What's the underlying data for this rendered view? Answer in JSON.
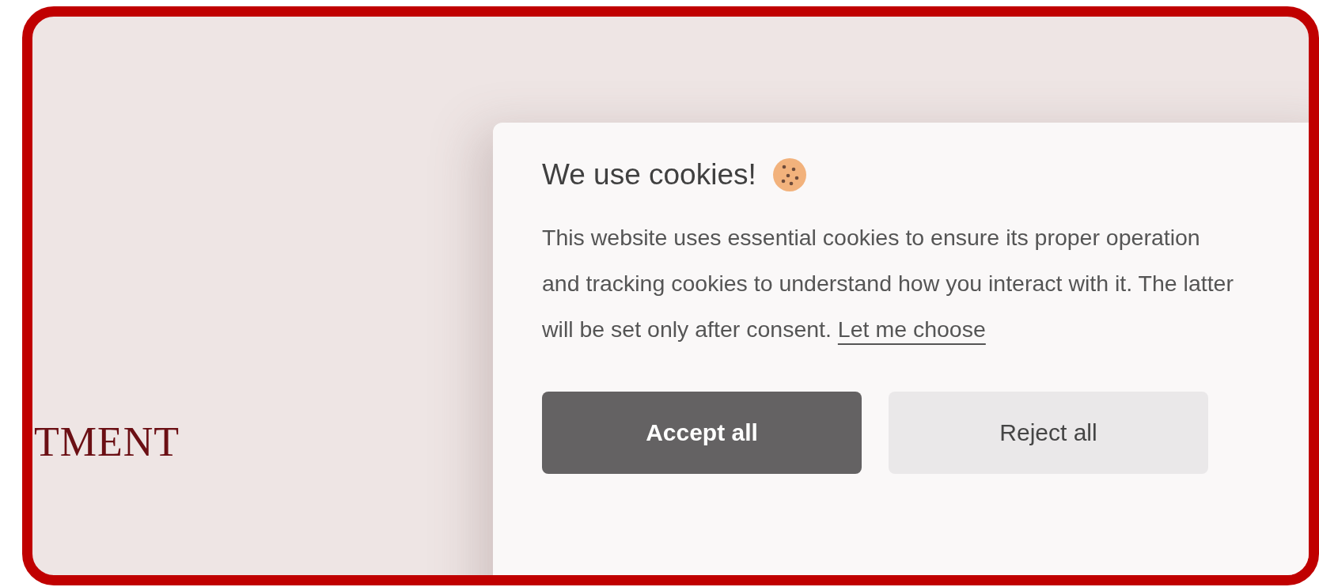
{
  "background_heading": "TMENT",
  "dialog": {
    "title": "We use cookies!",
    "body": "This website uses essential cookies to ensure its proper operation and tracking cookies to understand how you interact with it. The latter will be set only after consent.",
    "link": "Let me choose",
    "buttons": [
      {
        "label": "Accept all",
        "kind": "primary"
      },
      {
        "label": "Reject all",
        "kind": "secondary"
      }
    ]
  }
}
